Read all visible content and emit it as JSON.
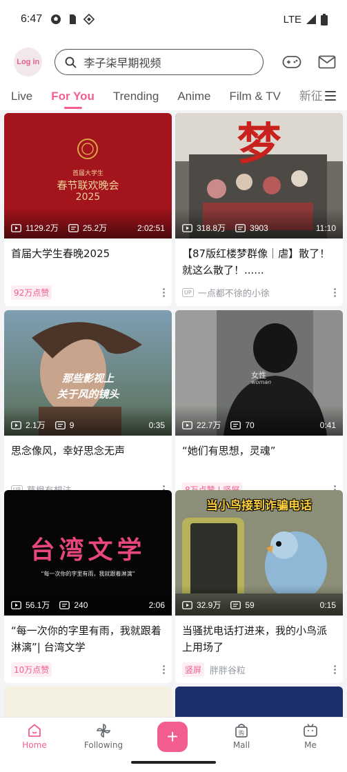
{
  "status": {
    "time": "6:47",
    "network": "LTE"
  },
  "header": {
    "login_label": "Log in",
    "search_placeholder": "李子柒早期视频"
  },
  "tabs": [
    "Live",
    "For You",
    "Trending",
    "Anime",
    "Film & TV",
    "新征"
  ],
  "cards": [
    {
      "views": "1129.2万",
      "comments": "25.2万",
      "duration": "2:02:51",
      "title": "首届大学生春晚2025",
      "badge": "92万点赞",
      "up_name": "",
      "thumb_text": [
        "首届大学生",
        "春节联欢晚会",
        "2025"
      ]
    },
    {
      "views": "318.8万",
      "comments": "3903",
      "duration": "11:10",
      "title": "【87版红楼梦群像｜虐】散了！就这么散了！......",
      "badge": "",
      "up_name": "一点都不徐的小徐",
      "thumb_text": [
        "梦"
      ]
    },
    {
      "views": "2.1万",
      "comments": "9",
      "duration": "0:35",
      "title": "思念像风，幸好思念无声",
      "badge": "",
      "up_name": "草根有想法",
      "thumb_text": [
        "那些影视上",
        "关于风的镜头"
      ]
    },
    {
      "views": "22.7万",
      "comments": "70",
      "duration": "0:41",
      "title": "“她们有思想，灵魂”",
      "badge": "8万点赞 | 竖屏",
      "up_name": "",
      "thumb_text": [
        "女性",
        "woman"
      ]
    },
    {
      "views": "56.1万",
      "comments": "240",
      "duration": "2:06",
      "title": "“每一次你的字里有雨，我就跟着淋漓”| 台湾文学",
      "badge": "10万点赞",
      "up_name": "",
      "thumb_text": [
        "台湾文学",
        "“每一次你的字里有雨，我就跟着淋漓”"
      ]
    },
    {
      "views": "32.9万",
      "comments": "59",
      "duration": "0:15",
      "title": "当骚扰电话打进来，我的小鸟派上用场了",
      "badge": "竖屏",
      "up_name": "胖胖谷粒",
      "thumb_text": [
        "当小鸟接到诈骗电话"
      ]
    }
  ],
  "bottom_nav": {
    "home": "Home",
    "following": "Following",
    "mall": "Mall",
    "me": "Me",
    "plus": "+"
  },
  "colors": {
    "accent": "#f25d8e",
    "background": "#f4f4f6"
  }
}
